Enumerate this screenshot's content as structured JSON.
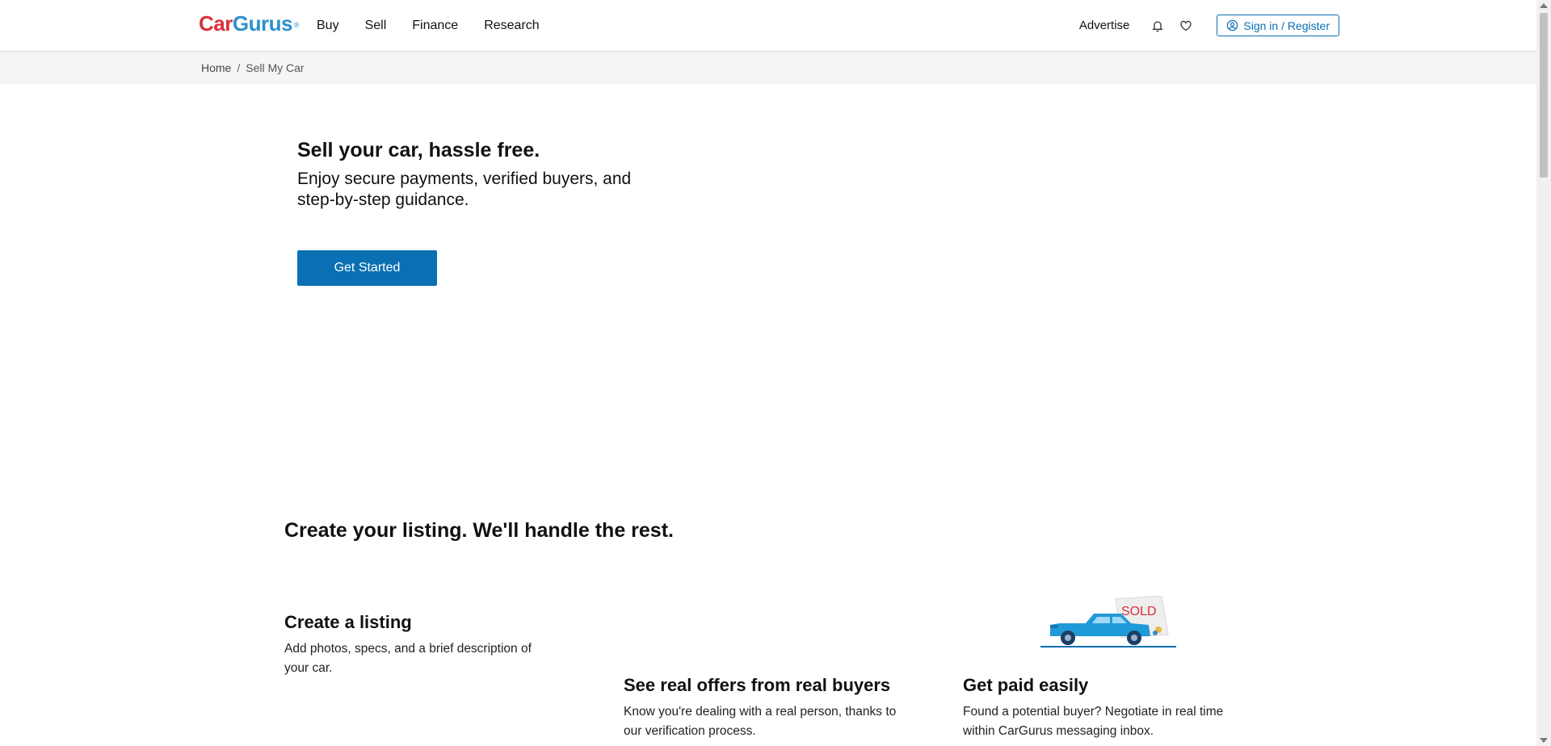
{
  "header": {
    "logo": {
      "part1": "Car",
      "part2": "Gurus",
      "mark": "®"
    },
    "nav": [
      "Buy",
      "Sell",
      "Finance",
      "Research"
    ],
    "advertise": "Advertise",
    "notifications_icon": "bell-icon",
    "favorites_icon": "heart-icon",
    "signin_label": "Sign in / Register",
    "signin_icon": "user-circle-icon"
  },
  "breadcrumb": {
    "home": "Home",
    "separator": "/",
    "current": "Sell My Car"
  },
  "hero": {
    "title": "Sell your car, hassle free.",
    "subtitle": "Enjoy secure payments, verified buyers, and step-by-step guidance.",
    "cta": "Get Started"
  },
  "how_it_works": {
    "title": "Create your listing. We'll handle the rest.",
    "steps": [
      {
        "title": "Create a listing",
        "text": "Add photos, specs, and a brief description of your car."
      },
      {
        "title": "See real offers from real buyers",
        "text": "Know you're dealing with a real person, thanks to our verification process."
      },
      {
        "title": "Get paid easily",
        "text": "Found a potential buyer? Negotiate in real time within CarGurus messaging inbox."
      }
    ],
    "illustration_sign": "SOLD"
  },
  "colors": {
    "brand_red": "#d9303a",
    "brand_blue": "#2f8fcf",
    "accent": "#0a6fb3",
    "breadcrumb_bg": "#f4f5f6"
  }
}
